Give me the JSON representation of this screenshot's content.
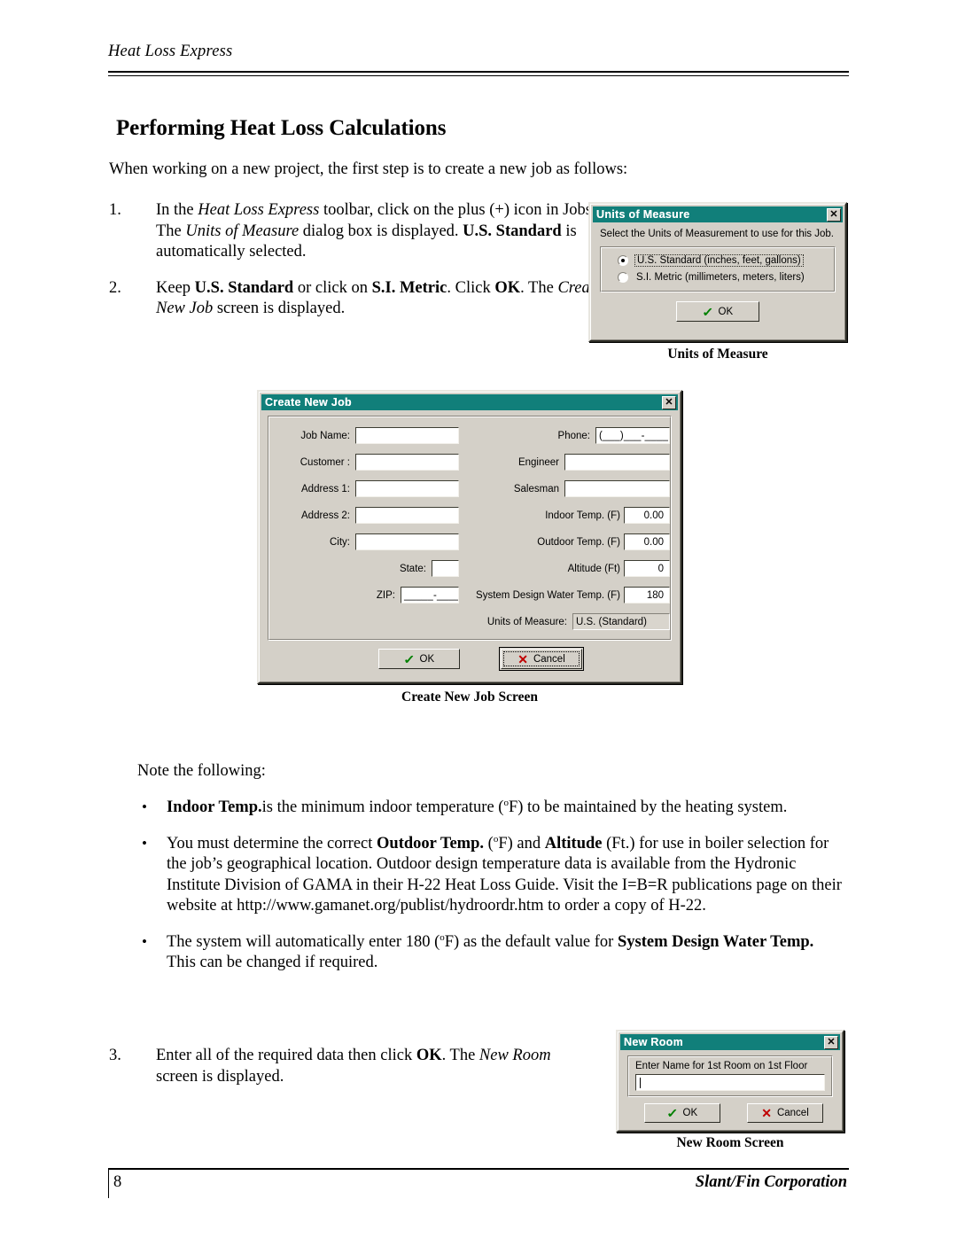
{
  "header": {
    "title": "Heat Loss Express"
  },
  "heading": {
    "text": "Performing Heat Loss Calculations"
  },
  "intro": {
    "text": "When working on a new project, the first step is to create a new job as follows:"
  },
  "steps": [
    {
      "number": "1.",
      "parts": [
        {
          "t": "In the ",
          "s": "normal"
        },
        {
          "t": "Heat Loss Express",
          "s": "italic"
        },
        {
          "t": " toolbar, click on the plus (+) icon in Jobs. The ",
          "s": "normal"
        },
        {
          "t": "Units of Measure",
          "s": "italic"
        },
        {
          "t": " dialog box is displayed. ",
          "s": "normal"
        },
        {
          "t": "U.S. Standard",
          "s": "bold"
        },
        {
          "t": " is automatically selected.",
          "s": "normal"
        }
      ]
    },
    {
      "number": "2.",
      "parts": [
        {
          "t": "Keep ",
          "s": "normal"
        },
        {
          "t": "U.S. Standard",
          "s": "bold"
        },
        {
          "t": " or click on ",
          "s": "normal"
        },
        {
          "t": "S.I. Metric",
          "s": "bold"
        },
        {
          "t": ". Click ",
          "s": "normal"
        },
        {
          "t": "OK",
          "s": "bold"
        },
        {
          "t": ". The ",
          "s": "normal"
        },
        {
          "t": "Create New Job",
          "s": "italic"
        },
        {
          "t": " screen is displayed.",
          "s": "normal"
        }
      ]
    }
  ],
  "step3": {
    "number": "3.",
    "parts": [
      {
        "t": "Enter all of the required data then click ",
        "s": "normal"
      },
      {
        "t": "OK",
        "s": "bold"
      },
      {
        "t": ". The ",
        "s": "normal"
      },
      {
        "t": "New Room",
        "s": "italic"
      },
      {
        "t": " screen is displayed.",
        "s": "normal"
      }
    ]
  },
  "notes": {
    "lead": "Note the following:",
    "bullet_glyph": "•",
    "items": [
      {
        "parts": [
          {
            "t": "Indoor Temp.",
            "s": "bold"
          },
          {
            "t": "is the minimum indoor temperature (",
            "s": "normal"
          },
          {
            "t": "o",
            "s": "sup"
          },
          {
            "t": "F) to be maintained by the heating system.",
            "s": "normal"
          }
        ]
      },
      {
        "parts": [
          {
            "t": "You must determine the correct ",
            "s": "normal"
          },
          {
            "t": "Outdoor Temp.",
            "s": "bold"
          },
          {
            "t": " (",
            "s": "normal"
          },
          {
            "t": "o",
            "s": "sup"
          },
          {
            "t": "F) and ",
            "s": "normal"
          },
          {
            "t": "Altitude",
            "s": "bold"
          },
          {
            "t": " (Ft.) for use in boiler selection for the job’s geographical location. Outdoor design temperature data is available from the Hydronic Institute Division of GAMA in their H-22 Heat Loss Guide.  Visit the I=B=R publications page on their website at ",
            "s": "normal"
          },
          {
            "t": "http://www.gamanet.org/publist/hydroordr.htm",
            "s": "link"
          },
          {
            "t": " to order a copy of H-22.",
            "s": "normal"
          }
        ]
      },
      {
        "parts": [
          {
            "t": "The system will automatically enter 180 (",
            "s": "normal"
          },
          {
            "t": "o",
            "s": "sup"
          },
          {
            "t": "F) as the default value for ",
            "s": "normal"
          },
          {
            "t": "System Design Water Temp.",
            "s": "bold"
          },
          {
            "t": " This can be changed if required.",
            "s": "normal"
          }
        ]
      }
    ]
  },
  "units_dialog": {
    "title": "Units of Measure",
    "close_label": "✕",
    "prompt": "Select the Units of Measurement to use for this Job.",
    "options": [
      {
        "label": "U.S. Standard (inches, feet, gallons)",
        "selected": true
      },
      {
        "label": "S.I. Metric (millimeters, meters, liters)",
        "selected": false
      }
    ],
    "ok_label": "OK",
    "caption": "Units of Measure"
  },
  "job_dialog": {
    "title": "Create New Job",
    "close_label": "✕",
    "left_fields": [
      {
        "label": "Job Name:",
        "value": ""
      },
      {
        "label": "Customer :",
        "value": ""
      },
      {
        "label": "Address 1:",
        "value": ""
      },
      {
        "label": "Address 2:",
        "value": ""
      },
      {
        "label": "City:",
        "value": ""
      },
      {
        "label": "State:",
        "value": ""
      },
      {
        "label": "ZIP:",
        "value": "_____-____"
      }
    ],
    "right_fields": [
      {
        "label": "Phone:",
        "value": "(___)___-____"
      },
      {
        "label": "Engineer",
        "value": ""
      },
      {
        "label": "Salesman",
        "value": ""
      },
      {
        "label": "Indoor Temp. (F)",
        "value": "0.00"
      },
      {
        "label": "Outdoor Temp. (F)",
        "value": "0.00"
      },
      {
        "label": "Altitude (Ft)",
        "value": "0"
      },
      {
        "label": "System Design Water Temp. (F)",
        "value": "180"
      }
    ],
    "units_label": "Units of Measure:",
    "units_value": "U.S. (Standard)",
    "ok_label": "OK",
    "cancel_label": "Cancel",
    "caption": "Create New Job Screen"
  },
  "room_dialog": {
    "title": "New Room",
    "close_label": "✕",
    "prompt": "Enter Name for 1st Room on 1st Floor",
    "value": "",
    "ok_label": "OK",
    "cancel_label": "Cancel",
    "caption": "New Room Screen"
  },
  "footer": {
    "page_number": "8",
    "corporation": "Slant/Fin Corporation"
  },
  "colors": {
    "titlebar": "#117f7a",
    "dialog_face": "#d4d0c8",
    "link": "#0000c0",
    "check_green": "#008000",
    "x_red": "#c00000"
  }
}
